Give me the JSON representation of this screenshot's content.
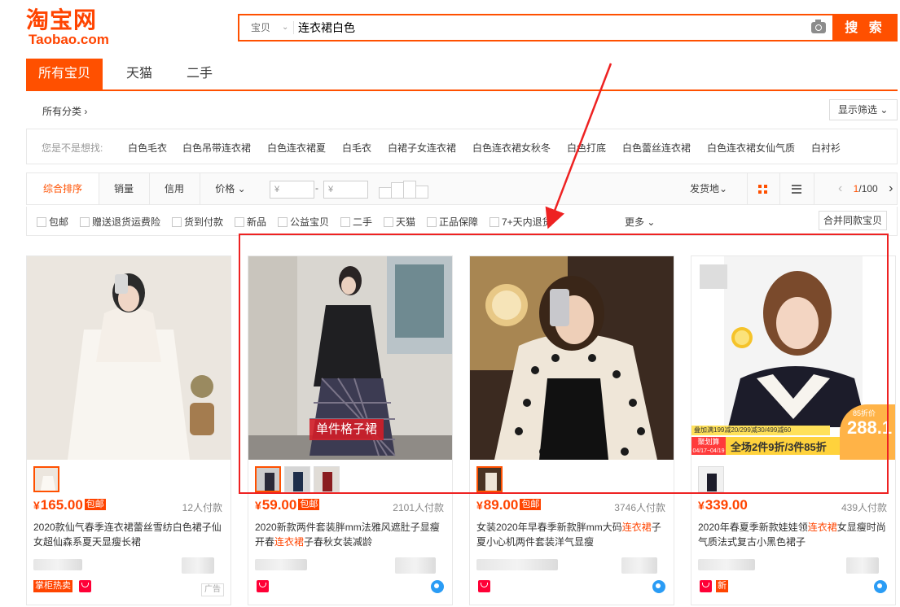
{
  "header": {
    "logo_cn": "淘宝网",
    "logo_en": "Taobao.com",
    "search_category": "宝贝",
    "search_query": "连衣裙白色",
    "search_button": "搜 索"
  },
  "tabs": [
    "所有宝贝",
    "天猫",
    "二手"
  ],
  "category": {
    "label": "所有分类 ›",
    "filter_button": "显示筛选 ⌄"
  },
  "suggestions": {
    "label": "您是不是想找:",
    "items": [
      "白色毛衣",
      "白色吊带连衣裙",
      "白色连衣裙夏",
      "白毛衣",
      "白裙子女连衣裙",
      "白色连衣裙女秋冬",
      "白色打底",
      "白色蕾丝连衣裙",
      "白色连衣裙女仙气质",
      "白衬衫"
    ]
  },
  "sortbar": {
    "items": [
      "综合排序",
      "销量",
      "信用",
      "价格 ⌄"
    ],
    "price_from_placeholder": "¥",
    "price_to_placeholder": "¥",
    "price_dash": "-",
    "ship_from": "发货地⌄",
    "pager_prev": "‹",
    "pager_current": "1",
    "pager_total": "/100",
    "pager_next": "›"
  },
  "checkboxes": [
    "包邮",
    "赠送退货运费险",
    "货到付款",
    "新品",
    "公益宝贝",
    "二手",
    "天猫",
    "正品保障",
    "7+天内退货"
  ],
  "more": "更多 ⌄",
  "merge_button": "合并同款宝贝",
  "products": [
    {
      "price": "165.00",
      "currency": "¥",
      "baoyou": "包邮",
      "sales": "12人付款",
      "title_parts": [
        "2020款仙气春季连衣裙蕾丝雪纺白色裙子仙女超仙森系夏天显瘦长裙",
        "",
        ""
      ],
      "badge": "掌柜热卖",
      "ad": "广告"
    },
    {
      "price": "59.00",
      "currency": "¥",
      "baoyou": "包邮",
      "sales": "2101人付款",
      "title_parts": [
        "2020新款两件套装胖mm法雅风遮肚子显瘦开春",
        "连衣裙",
        "子春秋女装减龄"
      ],
      "caption": "单件格子裙"
    },
    {
      "price": "89.00",
      "currency": "¥",
      "baoyou": "包邮",
      "sales": "3746人付款",
      "title_parts": [
        "女装2020年早春季新款胖mm大码",
        "连衣裙",
        "子夏小心机两件套装洋气显瘦"
      ]
    },
    {
      "price": "339.00",
      "currency": "¥",
      "baoyou": "",
      "sales": "439人付款",
      "title_parts": [
        "2020年春夏季新款娃娃领",
        "连衣裙",
        "女显瘦时尚气质法式复古小黑色裙子"
      ],
      "new_tag": "新",
      "promo": {
        "top_line": "叠加满199减20/299减30/499减60",
        "brand": "聚划算",
        "date": "04/17~04/19",
        "deal": "全场2件9折/3件85折",
        "discount_label": "85折价",
        "discount_price": "288.1"
      }
    }
  ],
  "colors": {
    "accent": "#ff5000",
    "price": "#ff4400",
    "annotation": "#ee2222"
  }
}
